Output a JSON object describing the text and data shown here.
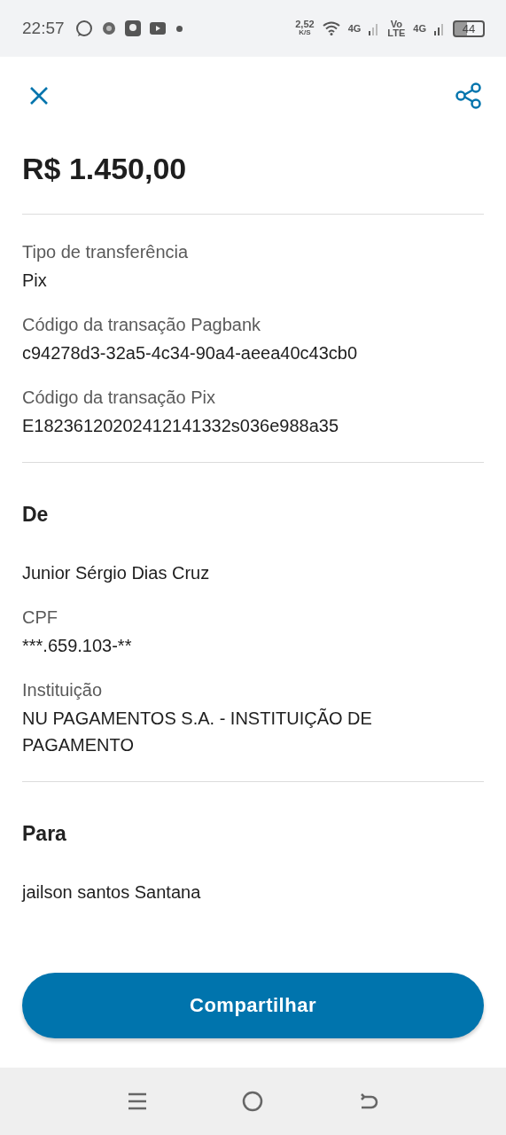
{
  "status_bar": {
    "time": "22:57",
    "speed": "2,52",
    "speed_unit": "K/S",
    "network_1": "4G",
    "volte_top": "Vo",
    "volte_bottom": "LTE",
    "network_2": "4G",
    "battery": "44"
  },
  "amount": "R$ 1.450,00",
  "sections": [
    {
      "fields": [
        {
          "label": "Tipo de transferência",
          "value": "Pix"
        },
        {
          "label": "Código da transação Pagbank",
          "value": "c94278d3-32a5-4c34-90a4-aeea40c43cb0"
        },
        {
          "label": "Código da transação Pix",
          "value": "E18236120202412141332s036e988a35"
        }
      ]
    },
    {
      "title": "De",
      "fields": [
        {
          "value": "Junior Sérgio Dias Cruz"
        },
        {
          "label": "CPF",
          "value": "***.659.103-**"
        },
        {
          "label": "Instituição",
          "value": "NU PAGAMENTOS S.A. - INSTITUIÇÃO DE PAGAMENTO"
        }
      ]
    },
    {
      "title": "Para",
      "fields": [
        {
          "value": "jailson santos Santana"
        }
      ]
    }
  ],
  "share_button": "Compartilhar"
}
